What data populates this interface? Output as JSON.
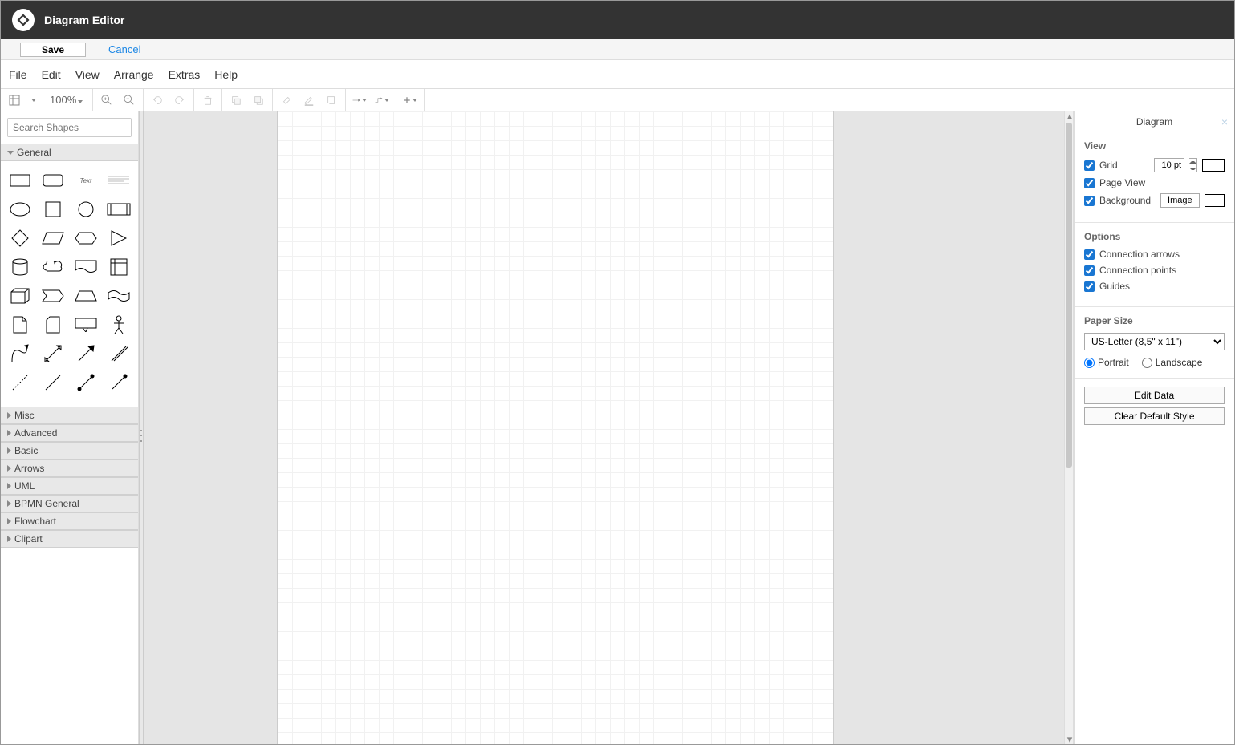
{
  "app_title": "Diagram Editor",
  "actions": {
    "save": "Save",
    "cancel": "Cancel"
  },
  "menus": [
    "File",
    "Edit",
    "View",
    "Arrange",
    "Extras",
    "Help"
  ],
  "toolbar": {
    "zoom": "100%"
  },
  "sidebar": {
    "search_placeholder": "Search Shapes",
    "categories_open": "General",
    "categories_closed": [
      "Misc",
      "Advanced",
      "Basic",
      "Arrows",
      "UML",
      "BPMN General",
      "Flowchart",
      "Clipart"
    ],
    "shape_text_label": "Text"
  },
  "right": {
    "tab": "Diagram",
    "view_heading": "View",
    "grid_label": "Grid",
    "grid_size": "10 pt",
    "pageview_label": "Page View",
    "background_label": "Background",
    "image_button": "Image",
    "options_heading": "Options",
    "conn_arrows_label": "Connection arrows",
    "conn_points_label": "Connection points",
    "guides_label": "Guides",
    "paper_heading": "Paper Size",
    "paper_value": "US-Letter (8,5\" x 11\")",
    "portrait": "Portrait",
    "landscape": "Landscape",
    "edit_data": "Edit Data",
    "clear_default": "Clear Default Style"
  }
}
